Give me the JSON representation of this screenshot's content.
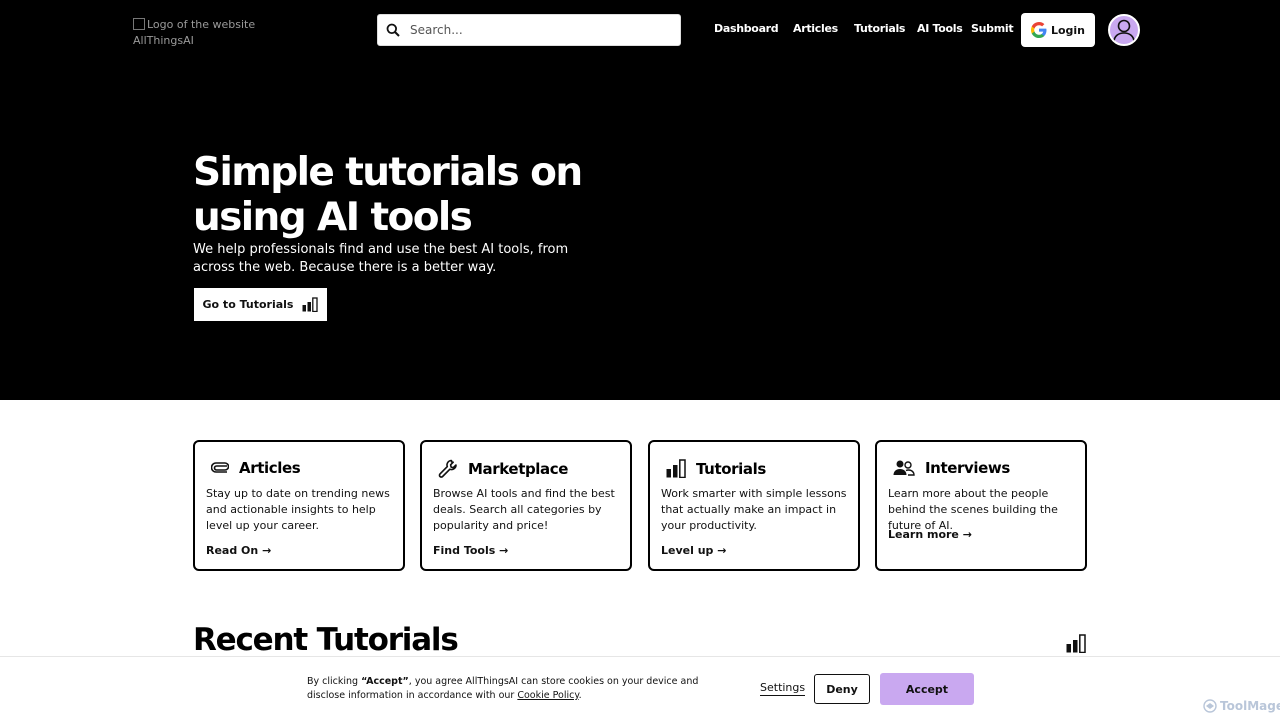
{
  "header": {
    "logo_alt": "Logo of the website AllThingsAI",
    "search_placeholder": "Search...",
    "nav": [
      "Dashboard",
      "Articles",
      "Tutorials",
      "AI Tools",
      "Submit"
    ],
    "login_label": "Login"
  },
  "hero": {
    "title_line1": "Simple tutorials on",
    "title_line2": "using AI tools",
    "subtitle": "We help professionals find and use the best AI tools, from across the web. Because there is a better way.",
    "cta_label": "Go to Tutorials"
  },
  "cards": [
    {
      "title": "Articles",
      "icon": "paperclip-icon",
      "desc": "Stay up to date on trending news and actionable insights to help level up your career.",
      "link": "Read On →"
    },
    {
      "title": "Marketplace",
      "icon": "wrench-icon",
      "desc": "Browse AI tools and find the best deals. Search all categories by popularity and price!",
      "link": "Find Tools →"
    },
    {
      "title": "Tutorials",
      "icon": "bar-chart-icon",
      "desc": "Work smarter with simple lessons that actually make an impact in your productivity.",
      "link": "Level up →"
    },
    {
      "title": "Interviews",
      "icon": "people-icon",
      "desc": "Learn more about the people behind the scenes building the future of AI.",
      "link": "Learn more →"
    }
  ],
  "recent": {
    "title": "Recent Tutorials"
  },
  "cookie": {
    "pre": "By clicking ",
    "accept_quote": "“Accept”",
    "mid": ", you agree AllThingsAI can store cookies on your device and disclose information in accordance with our ",
    "policy_link": "Cookie Policy",
    "end": ".",
    "settings_label": "Settings",
    "deny_label": "Deny",
    "accept_label": "Accept"
  },
  "watermark": "ToolMage",
  "colors": {
    "accent": "#c9a8f0",
    "hero_bg": "#000000"
  }
}
